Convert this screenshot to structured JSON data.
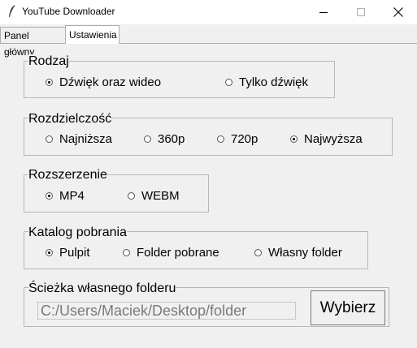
{
  "window": {
    "title": "YouTube Downloader"
  },
  "tabs": [
    {
      "label": "Panel główny"
    },
    {
      "label": "Ustawienia"
    }
  ],
  "groups": {
    "type": {
      "legend": "Rodzaj",
      "options": [
        {
          "label": "Dźwięk oraz wideo",
          "selected": true
        },
        {
          "label": "Tylko dźwięk",
          "selected": false
        }
      ]
    },
    "resolution": {
      "legend": "Rozdzielczość",
      "options": [
        {
          "label": "Najniższa",
          "selected": false
        },
        {
          "label": "360p",
          "selected": false
        },
        {
          "label": "720p",
          "selected": false
        },
        {
          "label": "Najwyższa",
          "selected": true
        }
      ]
    },
    "extension": {
      "legend": "Rozszerzenie",
      "options": [
        {
          "label": "MP4",
          "selected": true
        },
        {
          "label": "WEBM",
          "selected": false
        }
      ]
    },
    "download_dir": {
      "legend": "Katalog pobrania",
      "options": [
        {
          "label": "Pulpit",
          "selected": true
        },
        {
          "label": "Folder pobrane",
          "selected": false
        },
        {
          "label": "Własny folder",
          "selected": false
        }
      ]
    },
    "custom_path": {
      "legend": "Ścieżka własnego folderu",
      "value": "C:/Users/Maciek/Desktop/folder",
      "button_label": "Wybierz"
    }
  }
}
